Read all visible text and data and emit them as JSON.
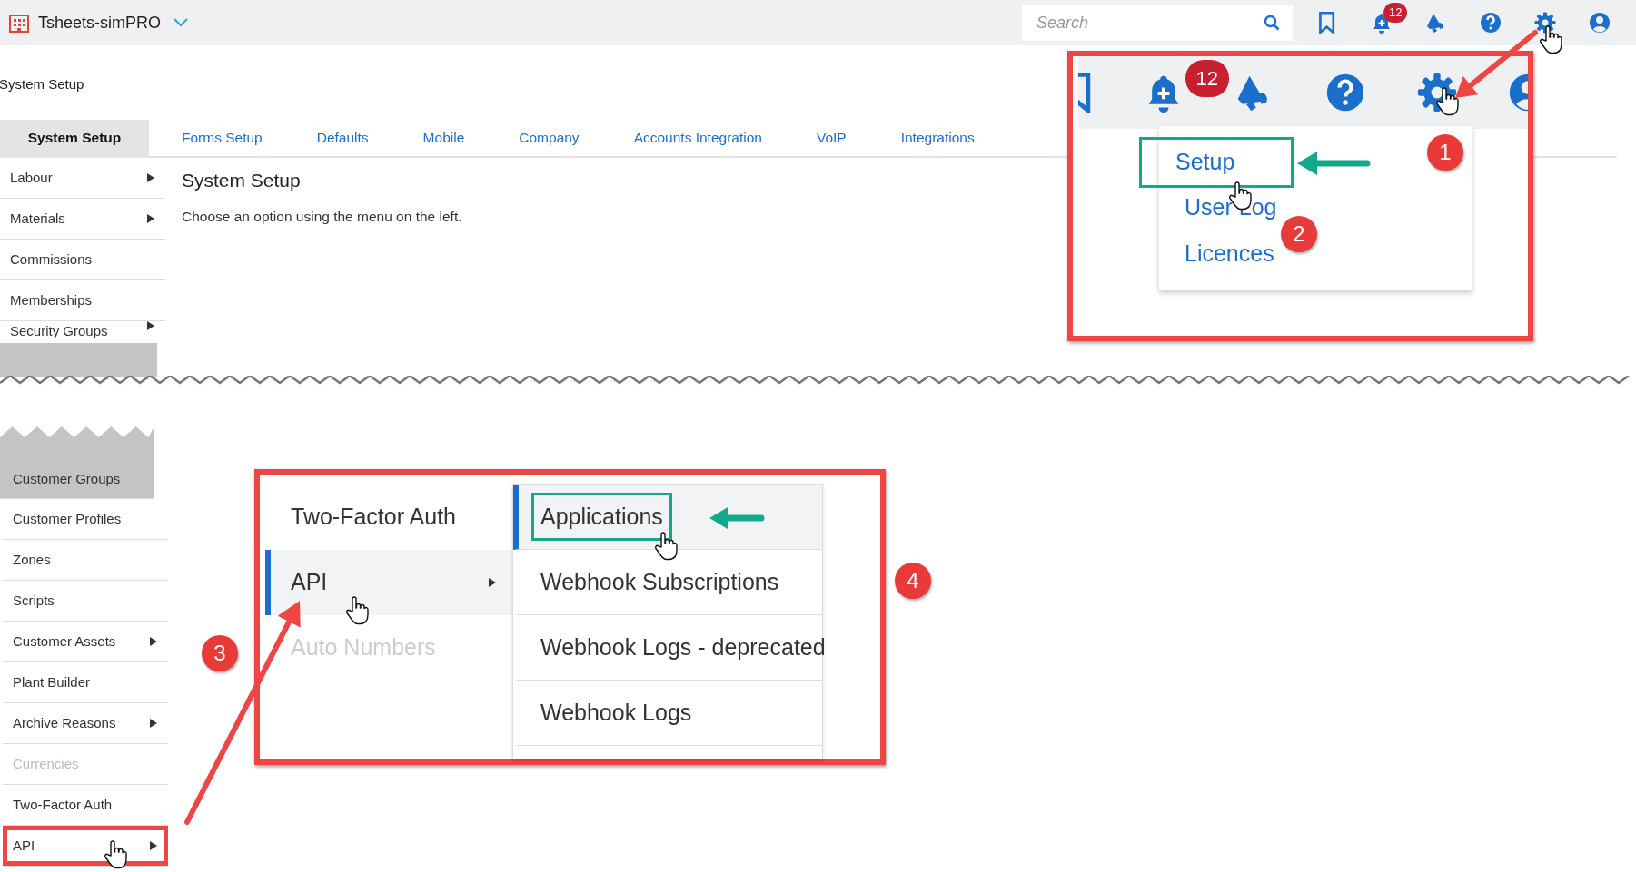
{
  "app_bar": {
    "title": "Tsheets-simPRO",
    "search": {
      "placeholder": "Search"
    },
    "notification_count": "12"
  },
  "page_title": "System Setup",
  "tabs": [
    {
      "label": "System Setup",
      "selected": true
    },
    {
      "label": "Forms Setup",
      "selected": false
    },
    {
      "label": "Defaults",
      "selected": false
    },
    {
      "label": "Mobile",
      "selected": false
    },
    {
      "label": "Company",
      "selected": false
    },
    {
      "label": "Accounts Integration",
      "selected": false
    },
    {
      "label": "VoIP",
      "selected": false
    },
    {
      "label": "Integrations",
      "selected": false
    }
  ],
  "sidebar_top": [
    {
      "label": "Labour",
      "has_submenu": true,
      "disabled": false
    },
    {
      "label": "Materials",
      "has_submenu": true,
      "disabled": false
    },
    {
      "label": "Commissions",
      "has_submenu": false,
      "disabled": false
    },
    {
      "label": "Memberships",
      "has_submenu": false,
      "disabled": false
    },
    {
      "label": "Security Groups",
      "has_submenu": true,
      "disabled": false
    }
  ],
  "content": {
    "heading": "System Setup",
    "text": "Choose an option using the menu on the left."
  },
  "settings_callout": {
    "notification_count": "12",
    "menu": [
      {
        "label": "Setup",
        "highlighted": true
      },
      {
        "label": "User Log",
        "highlighted": false
      },
      {
        "label": "Licences",
        "highlighted": false
      }
    ]
  },
  "sidebar_bottom": [
    {
      "label": "Customer Groups",
      "has_submenu": false,
      "disabled": false,
      "highlighted": false
    },
    {
      "label": "Customer Profiles",
      "has_submenu": false,
      "disabled": false,
      "highlighted": false
    },
    {
      "label": "Zones",
      "has_submenu": false,
      "disabled": false,
      "highlighted": false
    },
    {
      "label": "Scripts",
      "has_submenu": false,
      "disabled": false,
      "highlighted": false
    },
    {
      "label": "Customer Assets",
      "has_submenu": true,
      "disabled": false,
      "highlighted": false
    },
    {
      "label": "Plant Builder",
      "has_submenu": false,
      "disabled": false,
      "highlighted": false
    },
    {
      "label": "Archive Reasons",
      "has_submenu": true,
      "disabled": false,
      "highlighted": false
    },
    {
      "label": "Currencies",
      "has_submenu": false,
      "disabled": true,
      "highlighted": false
    },
    {
      "label": "Two-Factor Auth",
      "has_submenu": false,
      "disabled": false,
      "highlighted": false
    },
    {
      "label": "API",
      "has_submenu": true,
      "disabled": false,
      "highlighted": true
    }
  ],
  "menu_callout": {
    "menu": [
      {
        "label": "Two-Factor Auth",
        "has_submenu": false,
        "disabled": false,
        "selected": false
      },
      {
        "label": "API",
        "has_submenu": true,
        "disabled": false,
        "selected": true
      },
      {
        "label": "Auto Numbers",
        "has_submenu": false,
        "disabled": true,
        "selected": false
      }
    ],
    "submenu": [
      {
        "label": "Applications",
        "selected": true,
        "highlighted": true
      },
      {
        "label": "Webhook Subscriptions",
        "selected": false,
        "highlighted": false
      },
      {
        "label": "Webhook Logs - deprecated",
        "selected": false,
        "highlighted": false
      },
      {
        "label": "Webhook Logs",
        "selected": false,
        "highlighted": false
      }
    ]
  },
  "step_markers": [
    "1",
    "2",
    "3",
    "4"
  ]
}
